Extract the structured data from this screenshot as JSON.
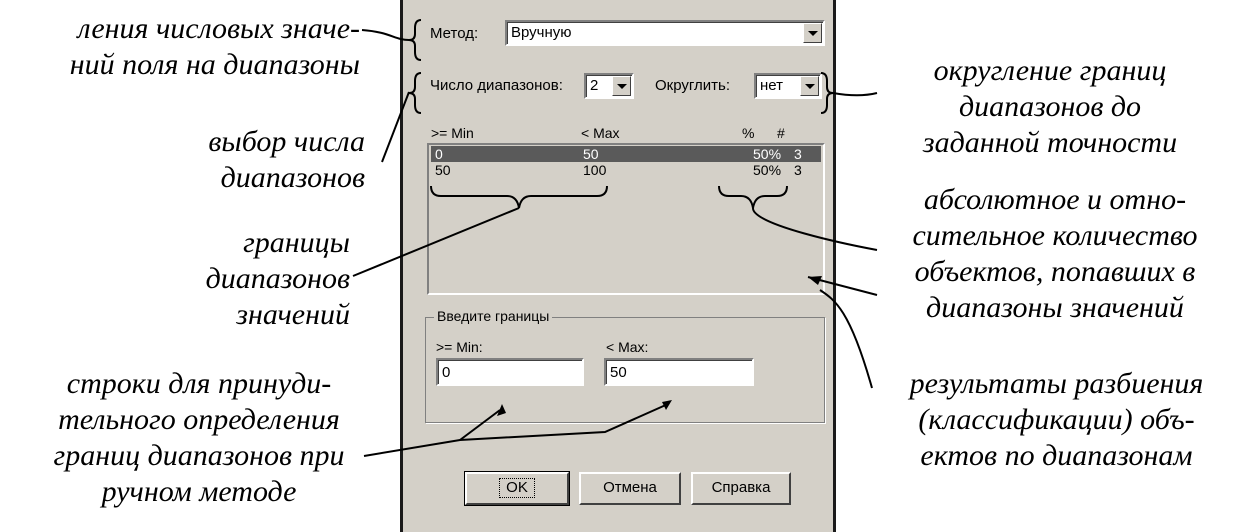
{
  "dialog": {
    "method_label": "Метод:",
    "method_value": "Вручную",
    "ranges_label": "Число диапазонов:",
    "ranges_value": "2",
    "round_label": "Округлить:",
    "round_value": "нет",
    "columns": [
      ">= Min",
      "< Max",
      "%",
      "#"
    ],
    "rows": [
      {
        "min": "0",
        "max": "50",
        "pct": "50%",
        "count": "3",
        "selected": true
      },
      {
        "min": "50",
        "max": "100",
        "pct": "50%",
        "count": "3",
        "selected": false
      }
    ],
    "group_title": "Введите границы",
    "min_label": ">= Min:",
    "max_label": "< Max:",
    "min_value": "0",
    "max_value": "50",
    "ok_label": "OK",
    "cancel_label": "Отмена",
    "help_label": "Справка"
  },
  "annotations": {
    "split_values": [
      "ления числовых значе-",
      "ний поля на диапазоны"
    ],
    "choose_count": [
      "выбор числа",
      "диапазонов"
    ],
    "range_bounds": [
      "границы",
      "диапазонов",
      "значений"
    ],
    "manual_rows": [
      "строки для принуди-",
      "тельного определения",
      "границ диапазонов при",
      "ручном методе"
    ],
    "rounding": [
      "округление границ",
      "диапазонов до",
      "заданной точности"
    ],
    "counts": [
      "абсолютное и отно-",
      "сительное количество",
      "объектов, попавших в",
      "диапазоны значений"
    ],
    "results": [
      "результаты разбиения",
      "(классификации) объ-",
      "ектов по диапазонам"
    ]
  }
}
